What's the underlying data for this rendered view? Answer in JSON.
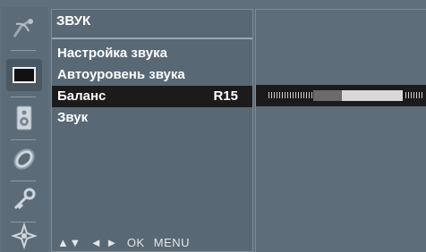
{
  "menu": {
    "title": "ЗВУК",
    "items": [
      {
        "label": "Настройка звука",
        "value": ""
      },
      {
        "label": "Автоуровень звука",
        "value": ""
      },
      {
        "label": "Баланс",
        "value": "R15"
      },
      {
        "label": "Звук",
        "value": ""
      }
    ],
    "selected_index": 2
  },
  "footer": {
    "arrows_updown": "▲▼",
    "arrows_leftright": "◄ ►",
    "ok": "OK",
    "menu": "MENU"
  },
  "icons": [
    "satellite-dish-icon",
    "screen-icon",
    "speaker-icon",
    "clock-icon",
    "key-icon",
    "settings-icon"
  ],
  "balance": {
    "value_label": "R15",
    "position_fraction": 0.65
  },
  "colors": {
    "background": "#5f6f7c",
    "selected_row": "#1b1b1b",
    "text": "#ffffff"
  }
}
